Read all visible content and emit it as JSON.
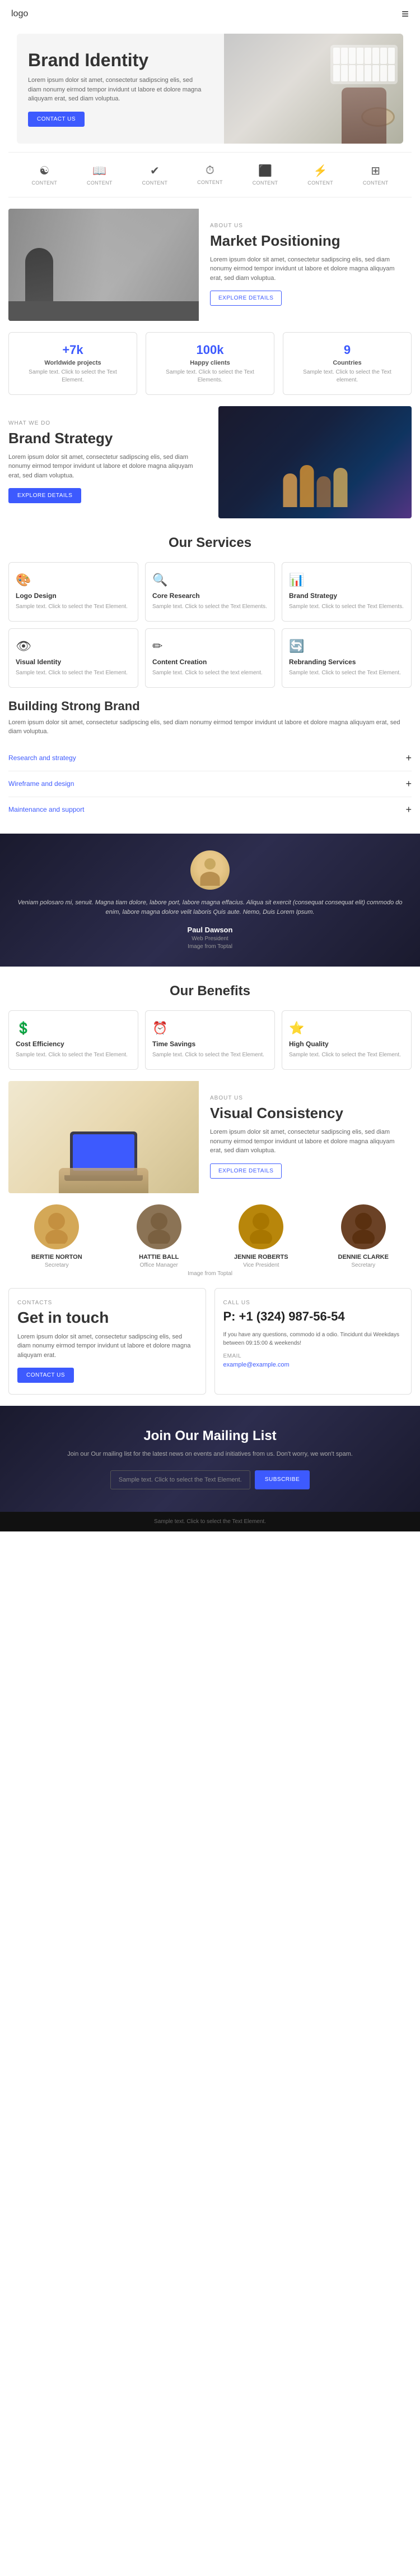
{
  "nav": {
    "logo": "logo",
    "hamburger_icon": "≡"
  },
  "hero": {
    "title": "Brand Identity",
    "description": "Lorem ipsum dolor sit amet, consectetur sadipscing elis, sed diam nonumy eirmod tempor invidunt ut labore et dolore magna aliquyam erat, sed diam voluptua.",
    "button_label": "CONTACT US"
  },
  "icons_row": [
    {
      "symbol": "☯",
      "label": "CONTENT"
    },
    {
      "symbol": "📚",
      "label": "CONTENT"
    },
    {
      "symbol": "✔",
      "label": "CONTENT"
    },
    {
      "symbol": "⏱",
      "label": "CONTENT"
    },
    {
      "symbol": "⬛",
      "label": "CONTENT"
    },
    {
      "symbol": "⚡",
      "label": "CONTENT"
    },
    {
      "symbol": "⊞",
      "label": "CONTENT"
    }
  ],
  "market_positioning": {
    "about_label": "ABOUT US",
    "title": "Market Positioning",
    "description": "Lorem ipsum dolor sit amet, consectetur sadipscing elis, sed diam nonumy eirmod tempor invidunt ut labore et dolore magna aliquyam erat, sed diam voluptua.",
    "button_label": "EXPLORE DETAILS"
  },
  "stats": [
    {
      "number": "+7k",
      "label": "Worldwide projects",
      "description": "Sample text. Click to select the Text Element."
    },
    {
      "number": "100k",
      "label": "Happy clients",
      "description": "Sample text. Click to select the Text Elements."
    },
    {
      "number": "9",
      "label": "Countries",
      "description": "Sample text. Click to select the Text element."
    }
  ],
  "brand_strategy": {
    "what_we_do_label": "WHAT WE DO",
    "title": "Brand Strategy",
    "description": "Lorem ipsum dolor sit amet, consectetur sadipscing elis, sed diam nonumy eirmod tempor invidunt ut labore et dolore magna aliquyam erat, sed diam voluptua.",
    "button_label": "EXPLORE DETAILS"
  },
  "services": {
    "section_title": "Our Services",
    "items": [
      {
        "icon": "🎨",
        "title": "Logo Design",
        "description": "Sample text. Click to select the Text Element."
      },
      {
        "icon": "🔍",
        "title": "Core Research",
        "description": "Sample text. Click to select the Text Elements."
      },
      {
        "icon": "📊",
        "title": "Brand Strategy",
        "description": "Sample text. Click to select the Text Elements."
      },
      {
        "icon": "👁",
        "title": "Visual Identity",
        "description": "Sample text. Click to select the Text Element."
      },
      {
        "icon": "✏",
        "title": "Content Creation",
        "description": "Sample text. Click to select the text element."
      },
      {
        "icon": "🔄",
        "title": "Rebranding Services",
        "description": "Sample text. Click to select the Text Element."
      }
    ]
  },
  "building": {
    "title": "Building Strong Brand",
    "description": "Lorem ipsum dolor sit amet, consectetur sadipscing elis, sed diam nonumy eirmod tempor invidunt ut labore et dolore magna aliquyam erat, sed diam voluptua.",
    "accordion_items": [
      {
        "label": "Research and strategy",
        "icon": "+"
      },
      {
        "label": "Wireframe and design",
        "icon": "+"
      },
      {
        "label": "Maintenance and support",
        "icon": "+"
      }
    ]
  },
  "testimonial": {
    "text": "Veniam polosaro mi, senuit. Magna tiam dolore, labore port, labore magna effacius. Aliqua sit exercit (consequat consequat elit) commodo do enim, labore magna dolore velit laboris Quis aute. Nemo, Duis Lorem Ipsum.",
    "name": "Paul Dawson",
    "role": "Web President",
    "company": "Image from Toptal"
  },
  "benefits": {
    "section_title": "Our Benefits",
    "items": [
      {
        "icon": "💲",
        "title": "Cost Efficiency",
        "description": "Sample text. Click to select the Text Element."
      },
      {
        "icon": "⏰",
        "title": "Time Savings",
        "description": "Sample text. Click to select the Text Element."
      },
      {
        "icon": "⭐",
        "title": "High Quality",
        "description": "Sample text. Click to select the Text Element."
      }
    ]
  },
  "visual_consistency": {
    "about_label": "ABOUT US",
    "title": "Visual Consistency",
    "description": "Lorem ipsum dolor sit amet, consectetur sadipscing elis, sed diam nonumy eirmod tempor invidunt ut labore et dolore magna aliquyam erat, sed diam voluptua.",
    "button_label": "EXPLORE DETAILS"
  },
  "team": {
    "members": [
      {
        "name": "BERTIE NORTON",
        "role": "Secretary",
        "color": "#d4a857"
      },
      {
        "name": "HATTIE BALL",
        "role": "Office Manager",
        "color": "#8B7355"
      },
      {
        "name": "JENNIE ROBERTS",
        "role": "Vice President",
        "color": "#b8860b"
      },
      {
        "name": "DENNIE CLARKE",
        "role": "Secretary",
        "color": "#6B4226"
      }
    ],
    "image_label": "Image from Toptal"
  },
  "contact": {
    "label": "CONTACTS",
    "title": "Get in touch",
    "description": "Lorem ipsum dolor sit amet, consectetur sadipscing elis, sed diam nonumy eirmod tempor invidunt ut labore et dolore magna aliquyam erat.",
    "button_label": "CONTACT US"
  },
  "call_us": {
    "label": "CALL US",
    "phone": "P: +1 (324) 987-56-54",
    "description": "If you have any questions, commodo id a odio. Tincidunt dui Weekdays between 09:15:00 & weekends!",
    "email_label": "EMAIL",
    "email": "example@example.com"
  },
  "mailing": {
    "title": "Join Our Mailing List",
    "description": "Join our Our mailing list for the latest news on events and initiatives from us. Don't worry, we won't spam.",
    "input_placeholder": "Sample text. Click to select the Text Element.",
    "button_label": "SUBSCRIBE"
  },
  "footer": {
    "text": "Sample text. Click to select the Text Element."
  }
}
